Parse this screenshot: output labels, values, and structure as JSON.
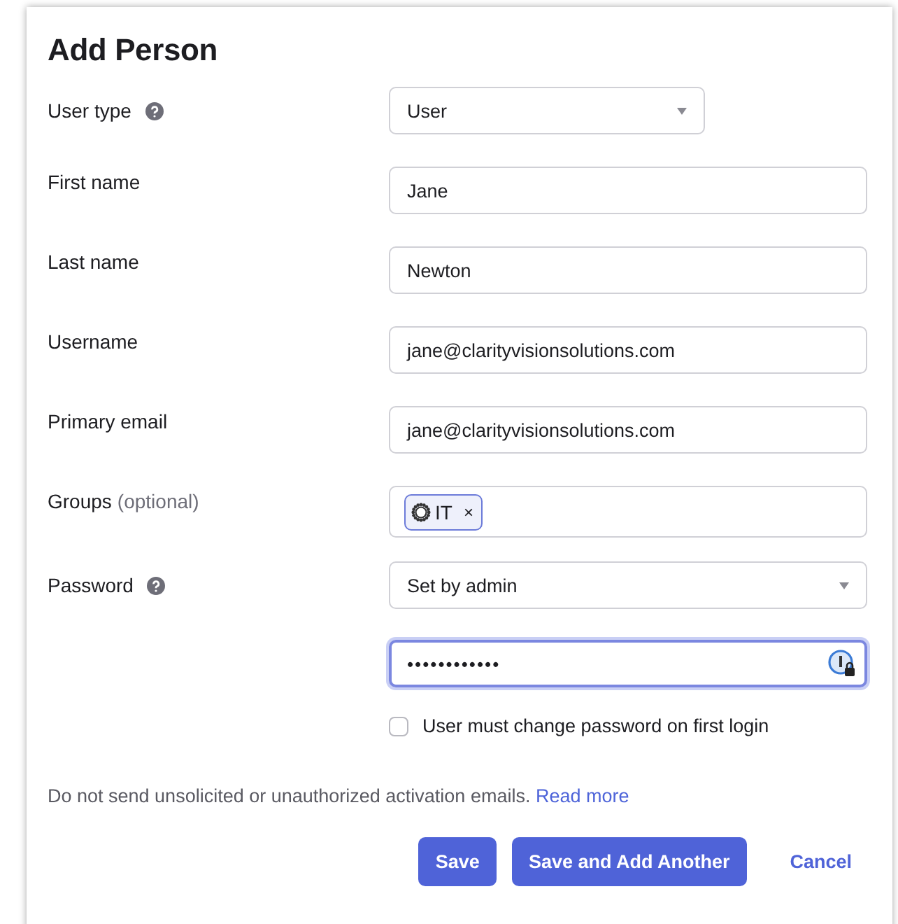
{
  "title": "Add Person",
  "fields": [
    {
      "kind": "select",
      "label": "User type",
      "help": true,
      "value": "User",
      "wide": false
    },
    {
      "kind": "text",
      "label": "First name",
      "value": "Jane"
    },
    {
      "kind": "text",
      "label": "Last name",
      "value": "Newton"
    },
    {
      "kind": "text",
      "label": "Username",
      "value": "jane@clarityvisionsolutions.com"
    },
    {
      "kind": "text",
      "label": "Primary email",
      "value": "jane@clarityvisionsolutions.com"
    },
    {
      "kind": "tags",
      "label": "Groups",
      "hint": "(optional)",
      "tags": [
        {
          "label": "IT",
          "remove": "×"
        }
      ]
    },
    {
      "kind": "select",
      "label": "Password",
      "help": true,
      "value": "Set by admin",
      "wide": true
    },
    {
      "kind": "password",
      "value": "••••••••••••",
      "focused": true
    },
    {
      "kind": "checkbox",
      "value": "User must change password on first login",
      "checked": false
    }
  ],
  "note": {
    "text": "Do not send unsolicited or unauthorized activation emails.",
    "link": "Read more"
  },
  "buttons": [
    {
      "label": "Save",
      "kind": "primary"
    },
    {
      "label": "Save and Add Another",
      "kind": "primary"
    },
    {
      "label": "Cancel",
      "kind": "link"
    }
  ]
}
